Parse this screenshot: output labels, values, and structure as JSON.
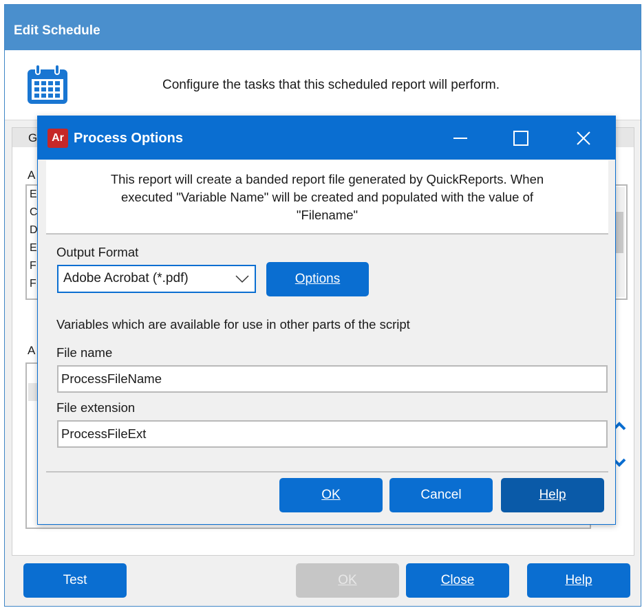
{
  "outer": {
    "title": "Edit Schedule",
    "description": "Configure the tasks that this scheduled report will perform.",
    "tab_fragment": "G",
    "label_fragment_1": "A",
    "label_fragment_2": "A",
    "list_fragments": [
      "E",
      "C",
      "D",
      "E",
      "F",
      "F"
    ],
    "buttons": {
      "test": "Test",
      "ok": "OK",
      "close": "Close",
      "help": "Help"
    }
  },
  "dialog": {
    "title": "Process Options",
    "app_icon_text": "Ar",
    "description_lines": [
      "This report will create a banded report file generated by QuickReports.  When",
      "executed \"Variable Name\" will be created and populated with the value of",
      "\"Filename\""
    ],
    "output_format_label": "Output Format",
    "output_format_value": "Adobe Acrobat (*.pdf)",
    "options_button": "Options",
    "variables_note": "Variables which are available for use in other parts of the script",
    "file_name_label": "File name",
    "file_name_value": "ProcessFileName",
    "file_ext_label": "File extension",
    "file_ext_value": "ProcessFileExt",
    "buttons": {
      "ok": "OK",
      "cancel": "Cancel",
      "help": "Help"
    }
  },
  "colors": {
    "accent": "#0a6ed1",
    "outer_title_bar": "#4a8fcd",
    "app_icon": "#c62828",
    "disabled": "#c6c6c6"
  },
  "icons": {
    "header": "calendar-icon",
    "dialog": "app-ar-icon",
    "minimize": "minimize-icon",
    "maximize": "maximize-icon",
    "close": "close-icon",
    "dropdown": "chevron-down-icon"
  }
}
